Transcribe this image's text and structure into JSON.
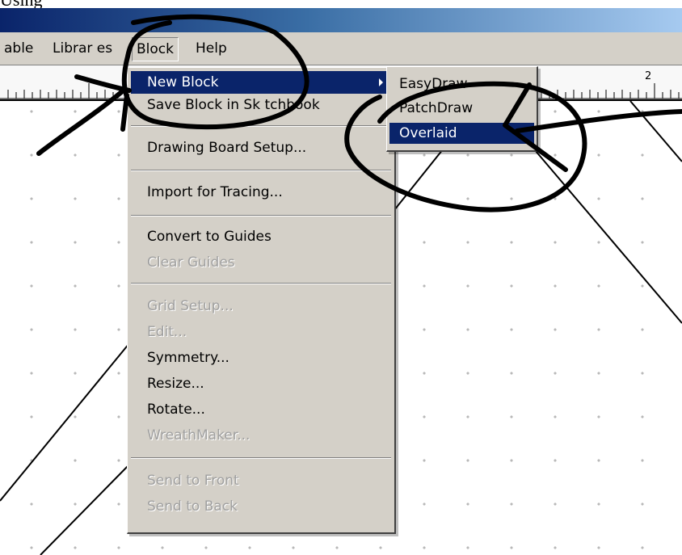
{
  "caption": "Using",
  "menubar": {
    "items": [
      {
        "label": "able",
        "name": "menu-table"
      },
      {
        "label": "Librar es",
        "name": "menu-libraries"
      },
      {
        "label": "Block",
        "name": "menu-block"
      },
      {
        "label": "Help",
        "name": "menu-help"
      }
    ]
  },
  "ruler": {
    "label_2": "2"
  },
  "block_menu": {
    "items": [
      {
        "label": "New Block",
        "state": "highlighted",
        "has_submenu": true
      },
      {
        "label": "Save Block in Sk tchbook",
        "state": "enabled"
      },
      {
        "label": "Drawing Board Setup...",
        "state": "enabled"
      },
      {
        "label": "Import for Tracing...",
        "state": "enabled"
      },
      {
        "label": "Convert to Guides",
        "state": "enabled"
      },
      {
        "label": "Clear Guides",
        "state": "disabled"
      },
      {
        "label": "Grid Setup...",
        "state": "disabled"
      },
      {
        "label": "Edit...",
        "state": "disabled"
      },
      {
        "label": "Symmetry...",
        "state": "enabled"
      },
      {
        "label": "Resize...",
        "state": "enabled"
      },
      {
        "label": "Rotate...",
        "state": "enabled"
      },
      {
        "label": "WreathMaker...",
        "state": "disabled"
      },
      {
        "label": "Send to Front",
        "state": "disabled"
      },
      {
        "label": "Send to Back",
        "state": "disabled"
      }
    ]
  },
  "new_block_submenu": {
    "items": [
      {
        "label": "EasyDraw",
        "state": "enabled"
      },
      {
        "label": "PatchDraw",
        "state": "enabled"
      },
      {
        "label": "Overlaid",
        "state": "highlighted"
      }
    ]
  },
  "colors": {
    "menu_face": "#d4d0c8",
    "highlight": "#0a246a",
    "titlebar_start": "#0a246a",
    "titlebar_end": "#a6caf0",
    "ink": "#000000"
  }
}
